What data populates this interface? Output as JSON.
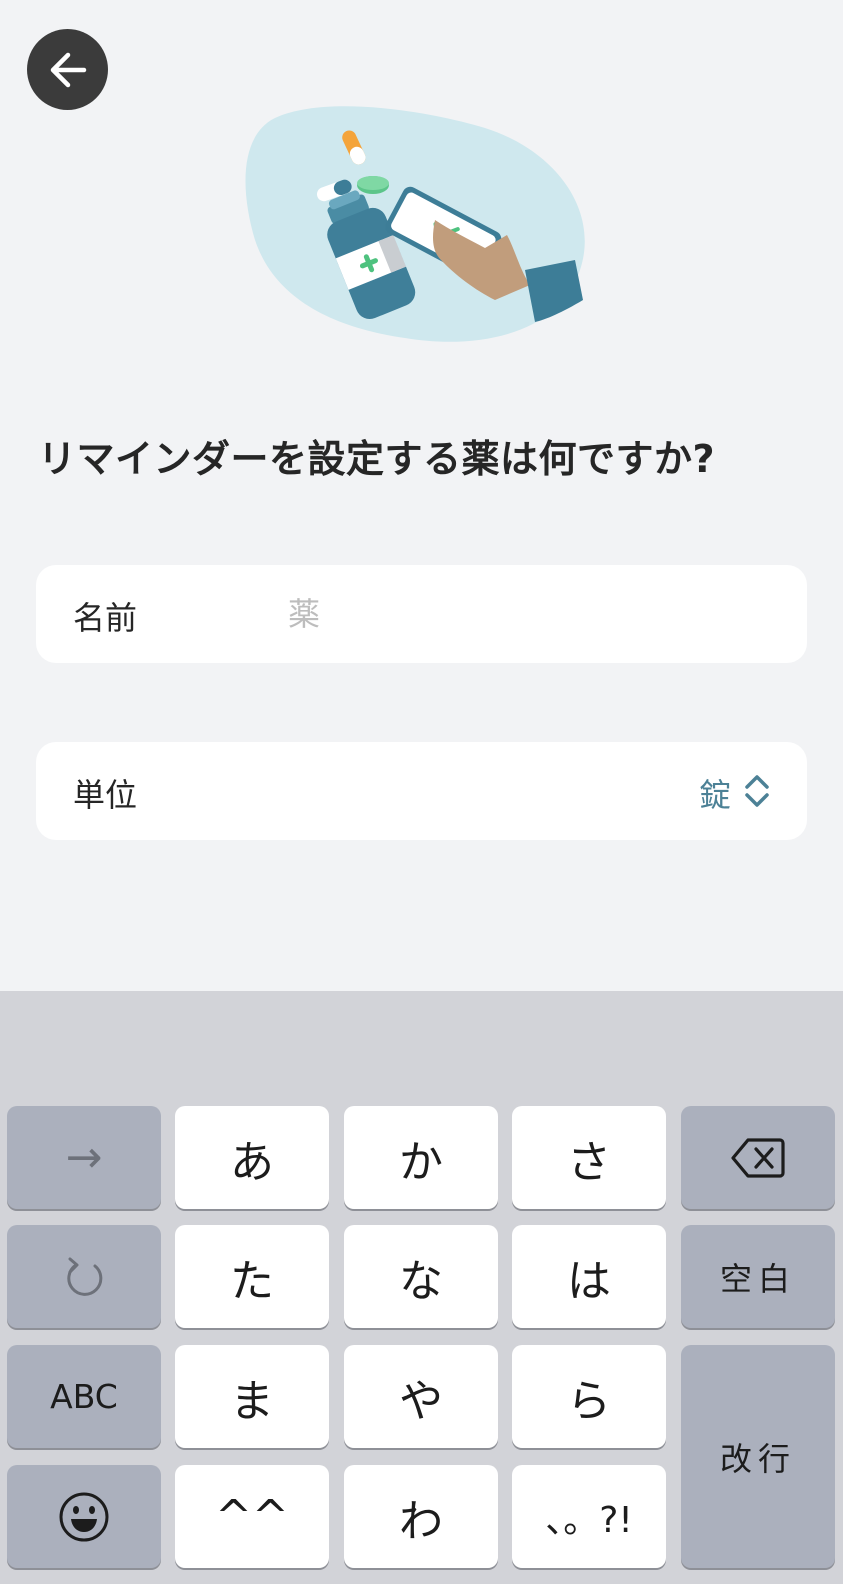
{
  "header": {
    "back_icon": "arrow-left-icon",
    "illustration": "medicine-bottle-phone-illustration"
  },
  "title": "リマインダーを設定する薬は何ですか?",
  "form": {
    "name_label": "名前",
    "name_value": "",
    "name_placeholder": "薬",
    "unit_label": "単位",
    "unit_value": "錠"
  },
  "keyboard": {
    "next_key": "→",
    "undo_icon": "undo-icon",
    "mode_key": "ABC",
    "emoji_icon": "emoji-icon",
    "kana_keys": [
      "あ",
      "か",
      "さ",
      "た",
      "な",
      "は",
      "ま",
      "や",
      "ら",
      "^^",
      "わ",
      "、。?!"
    ],
    "delete_icon": "backspace-icon",
    "space_key": "空白",
    "enter_key": "改行"
  },
  "colors": {
    "background": "#f2f3f5",
    "accent_teal": "#4c8196",
    "keyboard_bg": "#d2d3d8",
    "function_key": "#abb0bd",
    "back_button": "#3b3b3b"
  }
}
